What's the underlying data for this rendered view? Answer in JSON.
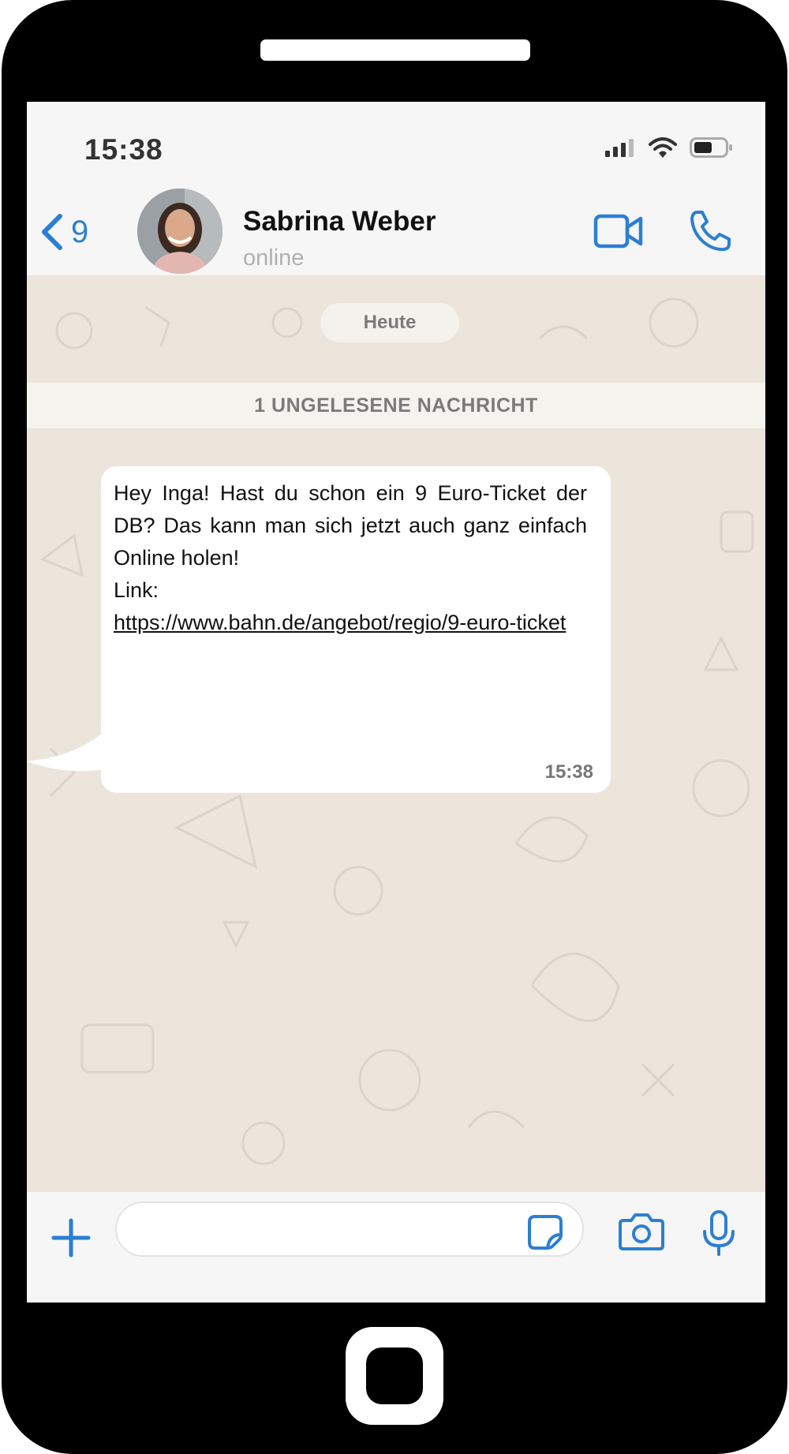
{
  "status_bar": {
    "time": "15:38"
  },
  "header": {
    "back_count": "9",
    "contact_name": "Sabrina Weber",
    "contact_status": "online"
  },
  "chat": {
    "day_label": "Heute",
    "unread_label": "1 UNGELESENE NACHRICHT",
    "message": {
      "text": "Hey Inga! Hast du schon ein 9 Euro-Ticket der DB? Das kann man sich jetzt auch ganz einfach Online holen!",
      "link_prefix": "Link:",
      "link_url": "https://www.bahn.de/angebot/regio/9-euro-ticket",
      "time": "15:38"
    }
  },
  "input_bar": {
    "placeholder": "",
    "value": ""
  },
  "icons": {
    "back": "chevron-left-icon",
    "video": "video-camera-icon",
    "call": "phone-icon",
    "add": "plus-icon",
    "sticker": "sticker-icon",
    "camera": "camera-icon",
    "mic": "microphone-icon"
  },
  "colors": {
    "accent": "#2b7fd3",
    "chat_background": "#ebe5dc",
    "bar_background": "#f6f6f6"
  }
}
